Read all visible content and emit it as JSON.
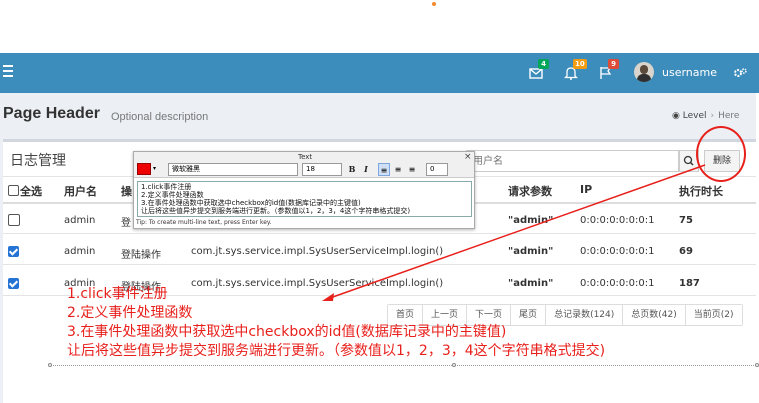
{
  "header": {
    "username": "username",
    "badges": {
      "messages": "4",
      "notifications": "10",
      "tasks": "9"
    },
    "badge_colors": {
      "messages": "#00a65a",
      "notifications": "#f39c12",
      "tasks": "#dd4b39"
    },
    "bar_color": "#3c8dbc"
  },
  "page": {
    "title": "Page Header",
    "description": "Optional description",
    "breadcrumb": {
      "level": "Level",
      "here": "Here"
    }
  },
  "box": {
    "title": "日志管理",
    "search_placeholder": "用户名",
    "delete_label": "删除"
  },
  "table": {
    "headers": {
      "select_all": "全选",
      "username": "用户名",
      "operation": "操",
      "params": "请求参数",
      "ip": "IP",
      "duration": "执行时长"
    },
    "rows": [
      {
        "checked": false,
        "username": "admin",
        "operation": "登",
        "method": "",
        "params": "\"admin\"",
        "ip": "0:0:0:0:0:0:0:1",
        "duration": "75"
      },
      {
        "checked": true,
        "username": "admin",
        "operation": "登陆操作",
        "method": "com.jt.sys.service.impl.SysUserServiceImpl.login()",
        "params": "\"admin\"",
        "ip": "0:0:0:0:0:0:0:1",
        "duration": "69"
      },
      {
        "checked": true,
        "username": "admin",
        "operation": "登陆操作",
        "method": "com.jt.sys.service.impl.SysUserServiceImpl.login()",
        "params": "\"admin\"",
        "ip": "0:0:0:0:0:0:0:1",
        "duration": "187"
      }
    ]
  },
  "pager": [
    "首页",
    "上一页",
    "下一页",
    "尾页",
    "总记录数(124)",
    "总页数(42)",
    "当前页(2)"
  ],
  "annotation": {
    "lines": [
      "1.click事件注册",
      "2.定义事件处理函数",
      "3.在事件处理函数中获取选中checkbox的id值(数据库记录中的主键值)",
      "让后将这些值异步提交到服务端进行更新。（参数值以1，2，3，4这个字符串格式提交)"
    ],
    "color": "#e8201c"
  },
  "text_tool": {
    "label": "Text",
    "font": "微软雅黑",
    "size": "18",
    "spacing": "0",
    "bold": "B",
    "italic": "I",
    "close": "×",
    "content": [
      "1.click事件注册",
      "2.定义事件处理函数",
      "3.在事件处理函数中获取选中checkbox的id值(数据库记录中的主键值)",
      "让后将这些值异步提交到服务端进行更新。（参数值以1，2，3，4这个字符串格式提交)"
    ],
    "tip": "Tip: To create multi-line text, press Enter key."
  }
}
